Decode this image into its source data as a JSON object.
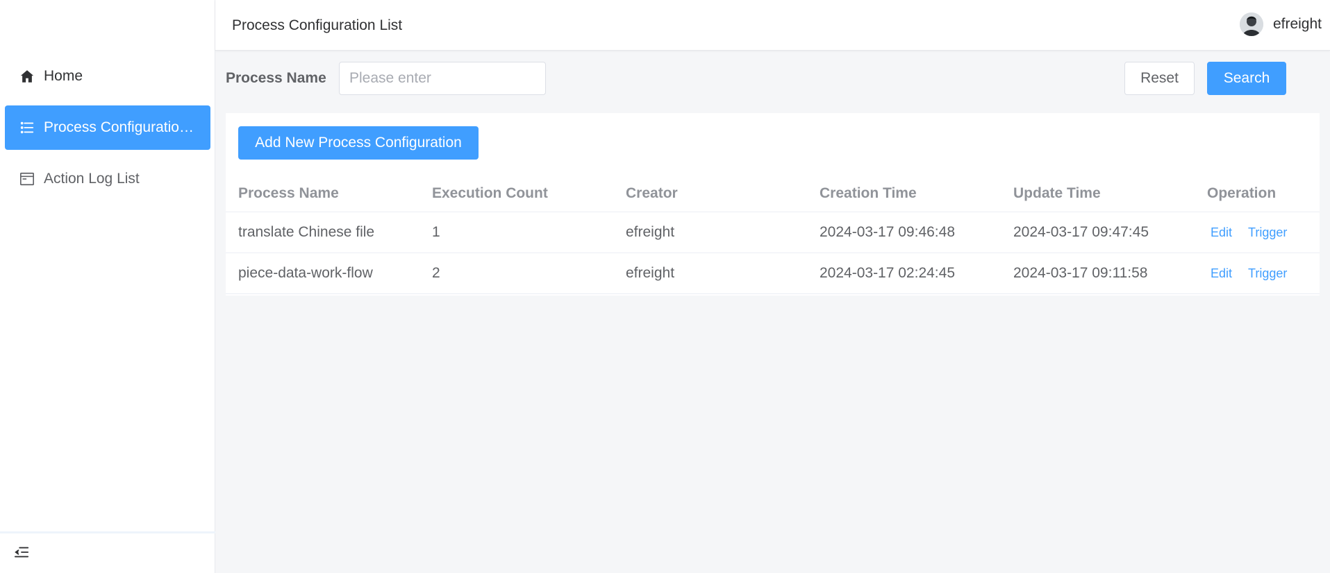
{
  "header": {
    "title": "Process Configuration List",
    "user_name": "efreight"
  },
  "sidebar": {
    "items": [
      {
        "label": "Home",
        "icon": "home-icon"
      },
      {
        "label": "Process Configuration List",
        "icon": "list-icon",
        "active": true
      },
      {
        "label": "Action Log List",
        "icon": "window-icon"
      }
    ],
    "collapse_icon": "collapse-menu-icon"
  },
  "search": {
    "label": "Process Name",
    "placeholder": "Please enter",
    "value": "",
    "reset_label": "Reset",
    "search_label": "Search"
  },
  "toolbar": {
    "add_label": "Add New Process Configuration"
  },
  "table": {
    "columns": [
      "Process Name",
      "Execution Count",
      "Creator",
      "Creation Time",
      "Update Time",
      "Operation"
    ],
    "rows": [
      {
        "process_name": "translate Chinese file",
        "execution_count": "1",
        "creator": "efreight",
        "creation_time": "2024-03-17 09:46:48",
        "update_time": "2024-03-17 09:47:45",
        "edit_label": "Edit",
        "trigger_label": "Trigger"
      },
      {
        "process_name": "piece-data-work-flow",
        "execution_count": "2",
        "creator": "efreight",
        "creation_time": "2024-03-17 02:24:45",
        "update_time": "2024-03-17 09:11:58",
        "edit_label": "Edit",
        "trigger_label": "Trigger"
      }
    ]
  },
  "colors": {
    "primary": "#409eff",
    "background": "#f5f6f8",
    "header_text": "#909399"
  }
}
